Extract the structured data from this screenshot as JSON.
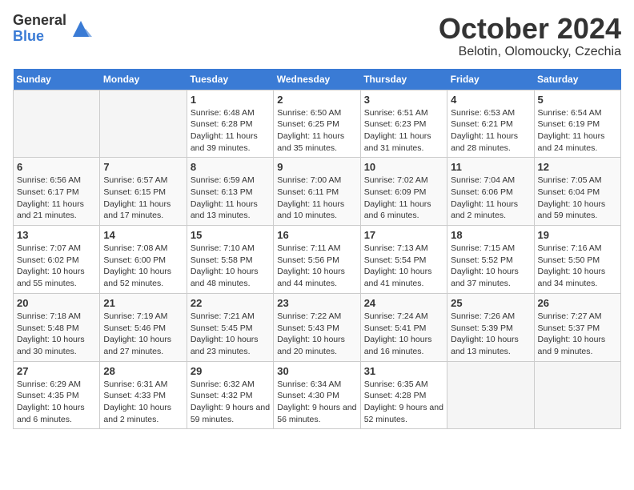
{
  "logo": {
    "general": "General",
    "blue": "Blue"
  },
  "title": "October 2024",
  "location": "Belotin, Olomoucky, Czechia",
  "days_header": [
    "Sunday",
    "Monday",
    "Tuesday",
    "Wednesday",
    "Thursday",
    "Friday",
    "Saturday"
  ],
  "weeks": [
    [
      {
        "day": "",
        "info": ""
      },
      {
        "day": "",
        "info": ""
      },
      {
        "day": "1",
        "info": "Sunrise: 6:48 AM\nSunset: 6:28 PM\nDaylight: 11 hours and 39 minutes."
      },
      {
        "day": "2",
        "info": "Sunrise: 6:50 AM\nSunset: 6:25 PM\nDaylight: 11 hours and 35 minutes."
      },
      {
        "day": "3",
        "info": "Sunrise: 6:51 AM\nSunset: 6:23 PM\nDaylight: 11 hours and 31 minutes."
      },
      {
        "day": "4",
        "info": "Sunrise: 6:53 AM\nSunset: 6:21 PM\nDaylight: 11 hours and 28 minutes."
      },
      {
        "day": "5",
        "info": "Sunrise: 6:54 AM\nSunset: 6:19 PM\nDaylight: 11 hours and 24 minutes."
      }
    ],
    [
      {
        "day": "6",
        "info": "Sunrise: 6:56 AM\nSunset: 6:17 PM\nDaylight: 11 hours and 21 minutes."
      },
      {
        "day": "7",
        "info": "Sunrise: 6:57 AM\nSunset: 6:15 PM\nDaylight: 11 hours and 17 minutes."
      },
      {
        "day": "8",
        "info": "Sunrise: 6:59 AM\nSunset: 6:13 PM\nDaylight: 11 hours and 13 minutes."
      },
      {
        "day": "9",
        "info": "Sunrise: 7:00 AM\nSunset: 6:11 PM\nDaylight: 11 hours and 10 minutes."
      },
      {
        "day": "10",
        "info": "Sunrise: 7:02 AM\nSunset: 6:09 PM\nDaylight: 11 hours and 6 minutes."
      },
      {
        "day": "11",
        "info": "Sunrise: 7:04 AM\nSunset: 6:06 PM\nDaylight: 11 hours and 2 minutes."
      },
      {
        "day": "12",
        "info": "Sunrise: 7:05 AM\nSunset: 6:04 PM\nDaylight: 10 hours and 59 minutes."
      }
    ],
    [
      {
        "day": "13",
        "info": "Sunrise: 7:07 AM\nSunset: 6:02 PM\nDaylight: 10 hours and 55 minutes."
      },
      {
        "day": "14",
        "info": "Sunrise: 7:08 AM\nSunset: 6:00 PM\nDaylight: 10 hours and 52 minutes."
      },
      {
        "day": "15",
        "info": "Sunrise: 7:10 AM\nSunset: 5:58 PM\nDaylight: 10 hours and 48 minutes."
      },
      {
        "day": "16",
        "info": "Sunrise: 7:11 AM\nSunset: 5:56 PM\nDaylight: 10 hours and 44 minutes."
      },
      {
        "day": "17",
        "info": "Sunrise: 7:13 AM\nSunset: 5:54 PM\nDaylight: 10 hours and 41 minutes."
      },
      {
        "day": "18",
        "info": "Sunrise: 7:15 AM\nSunset: 5:52 PM\nDaylight: 10 hours and 37 minutes."
      },
      {
        "day": "19",
        "info": "Sunrise: 7:16 AM\nSunset: 5:50 PM\nDaylight: 10 hours and 34 minutes."
      }
    ],
    [
      {
        "day": "20",
        "info": "Sunrise: 7:18 AM\nSunset: 5:48 PM\nDaylight: 10 hours and 30 minutes."
      },
      {
        "day": "21",
        "info": "Sunrise: 7:19 AM\nSunset: 5:46 PM\nDaylight: 10 hours and 27 minutes."
      },
      {
        "day": "22",
        "info": "Sunrise: 7:21 AM\nSunset: 5:45 PM\nDaylight: 10 hours and 23 minutes."
      },
      {
        "day": "23",
        "info": "Sunrise: 7:22 AM\nSunset: 5:43 PM\nDaylight: 10 hours and 20 minutes."
      },
      {
        "day": "24",
        "info": "Sunrise: 7:24 AM\nSunset: 5:41 PM\nDaylight: 10 hours and 16 minutes."
      },
      {
        "day": "25",
        "info": "Sunrise: 7:26 AM\nSunset: 5:39 PM\nDaylight: 10 hours and 13 minutes."
      },
      {
        "day": "26",
        "info": "Sunrise: 7:27 AM\nSunset: 5:37 PM\nDaylight: 10 hours and 9 minutes."
      }
    ],
    [
      {
        "day": "27",
        "info": "Sunrise: 6:29 AM\nSunset: 4:35 PM\nDaylight: 10 hours and 6 minutes."
      },
      {
        "day": "28",
        "info": "Sunrise: 6:31 AM\nSunset: 4:33 PM\nDaylight: 10 hours and 2 minutes."
      },
      {
        "day": "29",
        "info": "Sunrise: 6:32 AM\nSunset: 4:32 PM\nDaylight: 9 hours and 59 minutes."
      },
      {
        "day": "30",
        "info": "Sunrise: 6:34 AM\nSunset: 4:30 PM\nDaylight: 9 hours and 56 minutes."
      },
      {
        "day": "31",
        "info": "Sunrise: 6:35 AM\nSunset: 4:28 PM\nDaylight: 9 hours and 52 minutes."
      },
      {
        "day": "",
        "info": ""
      },
      {
        "day": "",
        "info": ""
      }
    ]
  ]
}
